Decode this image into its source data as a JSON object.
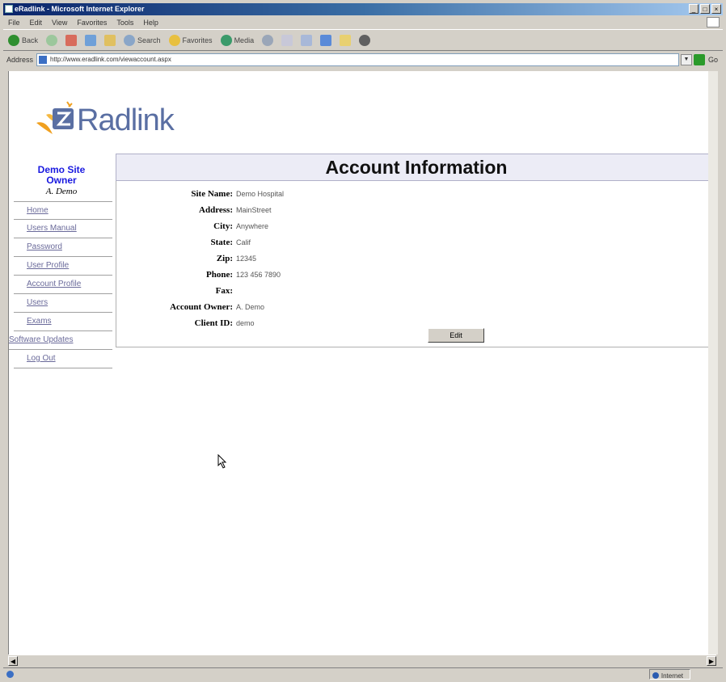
{
  "window": {
    "title": "eRadlink - Microsoft Internet Explorer",
    "controls": [
      "_",
      "□",
      "×"
    ]
  },
  "menu": [
    "File",
    "Edit",
    "View",
    "Favorites",
    "Tools",
    "Help"
  ],
  "toolbar": {
    "back": "Back",
    "search": "Search",
    "favorites": "Favorites",
    "media": "Media"
  },
  "address": {
    "label": "Address",
    "url": "http://www.eradlink.com/viewaccount.aspx",
    "go": "Go"
  },
  "logo": {
    "text": "Radlink"
  },
  "user": {
    "role_line1": "Demo Site",
    "role_line2": "Owner",
    "name": "A. Demo"
  },
  "nav": [
    "Home",
    "Users Manual",
    "Password",
    "User Profile",
    "Account Profile",
    "Users",
    "Exams",
    "Software Updates",
    "Log Out"
  ],
  "page": {
    "title": "Account Information",
    "fields": [
      {
        "label": "Site Name:",
        "value": "Demo Hospital"
      },
      {
        "label": "Address:",
        "value": "MainStreet"
      },
      {
        "label": "City:",
        "value": "Anywhere"
      },
      {
        "label": "State:",
        "value": "Calif"
      },
      {
        "label": "Zip:",
        "value": "12345"
      },
      {
        "label": "Phone:",
        "value": "123 456 7890"
      },
      {
        "label": "Fax:",
        "value": ""
      },
      {
        "label": "Account Owner:",
        "value": "A. Demo"
      },
      {
        "label": "Client ID:",
        "value": "demo"
      }
    ],
    "edit_label": "Edit"
  },
  "status": {
    "zone": "Internet"
  },
  "colors": {
    "accent": "#1a1ae0",
    "header_bg": "#ececf6",
    "logo_text": "#5a6fa3"
  }
}
